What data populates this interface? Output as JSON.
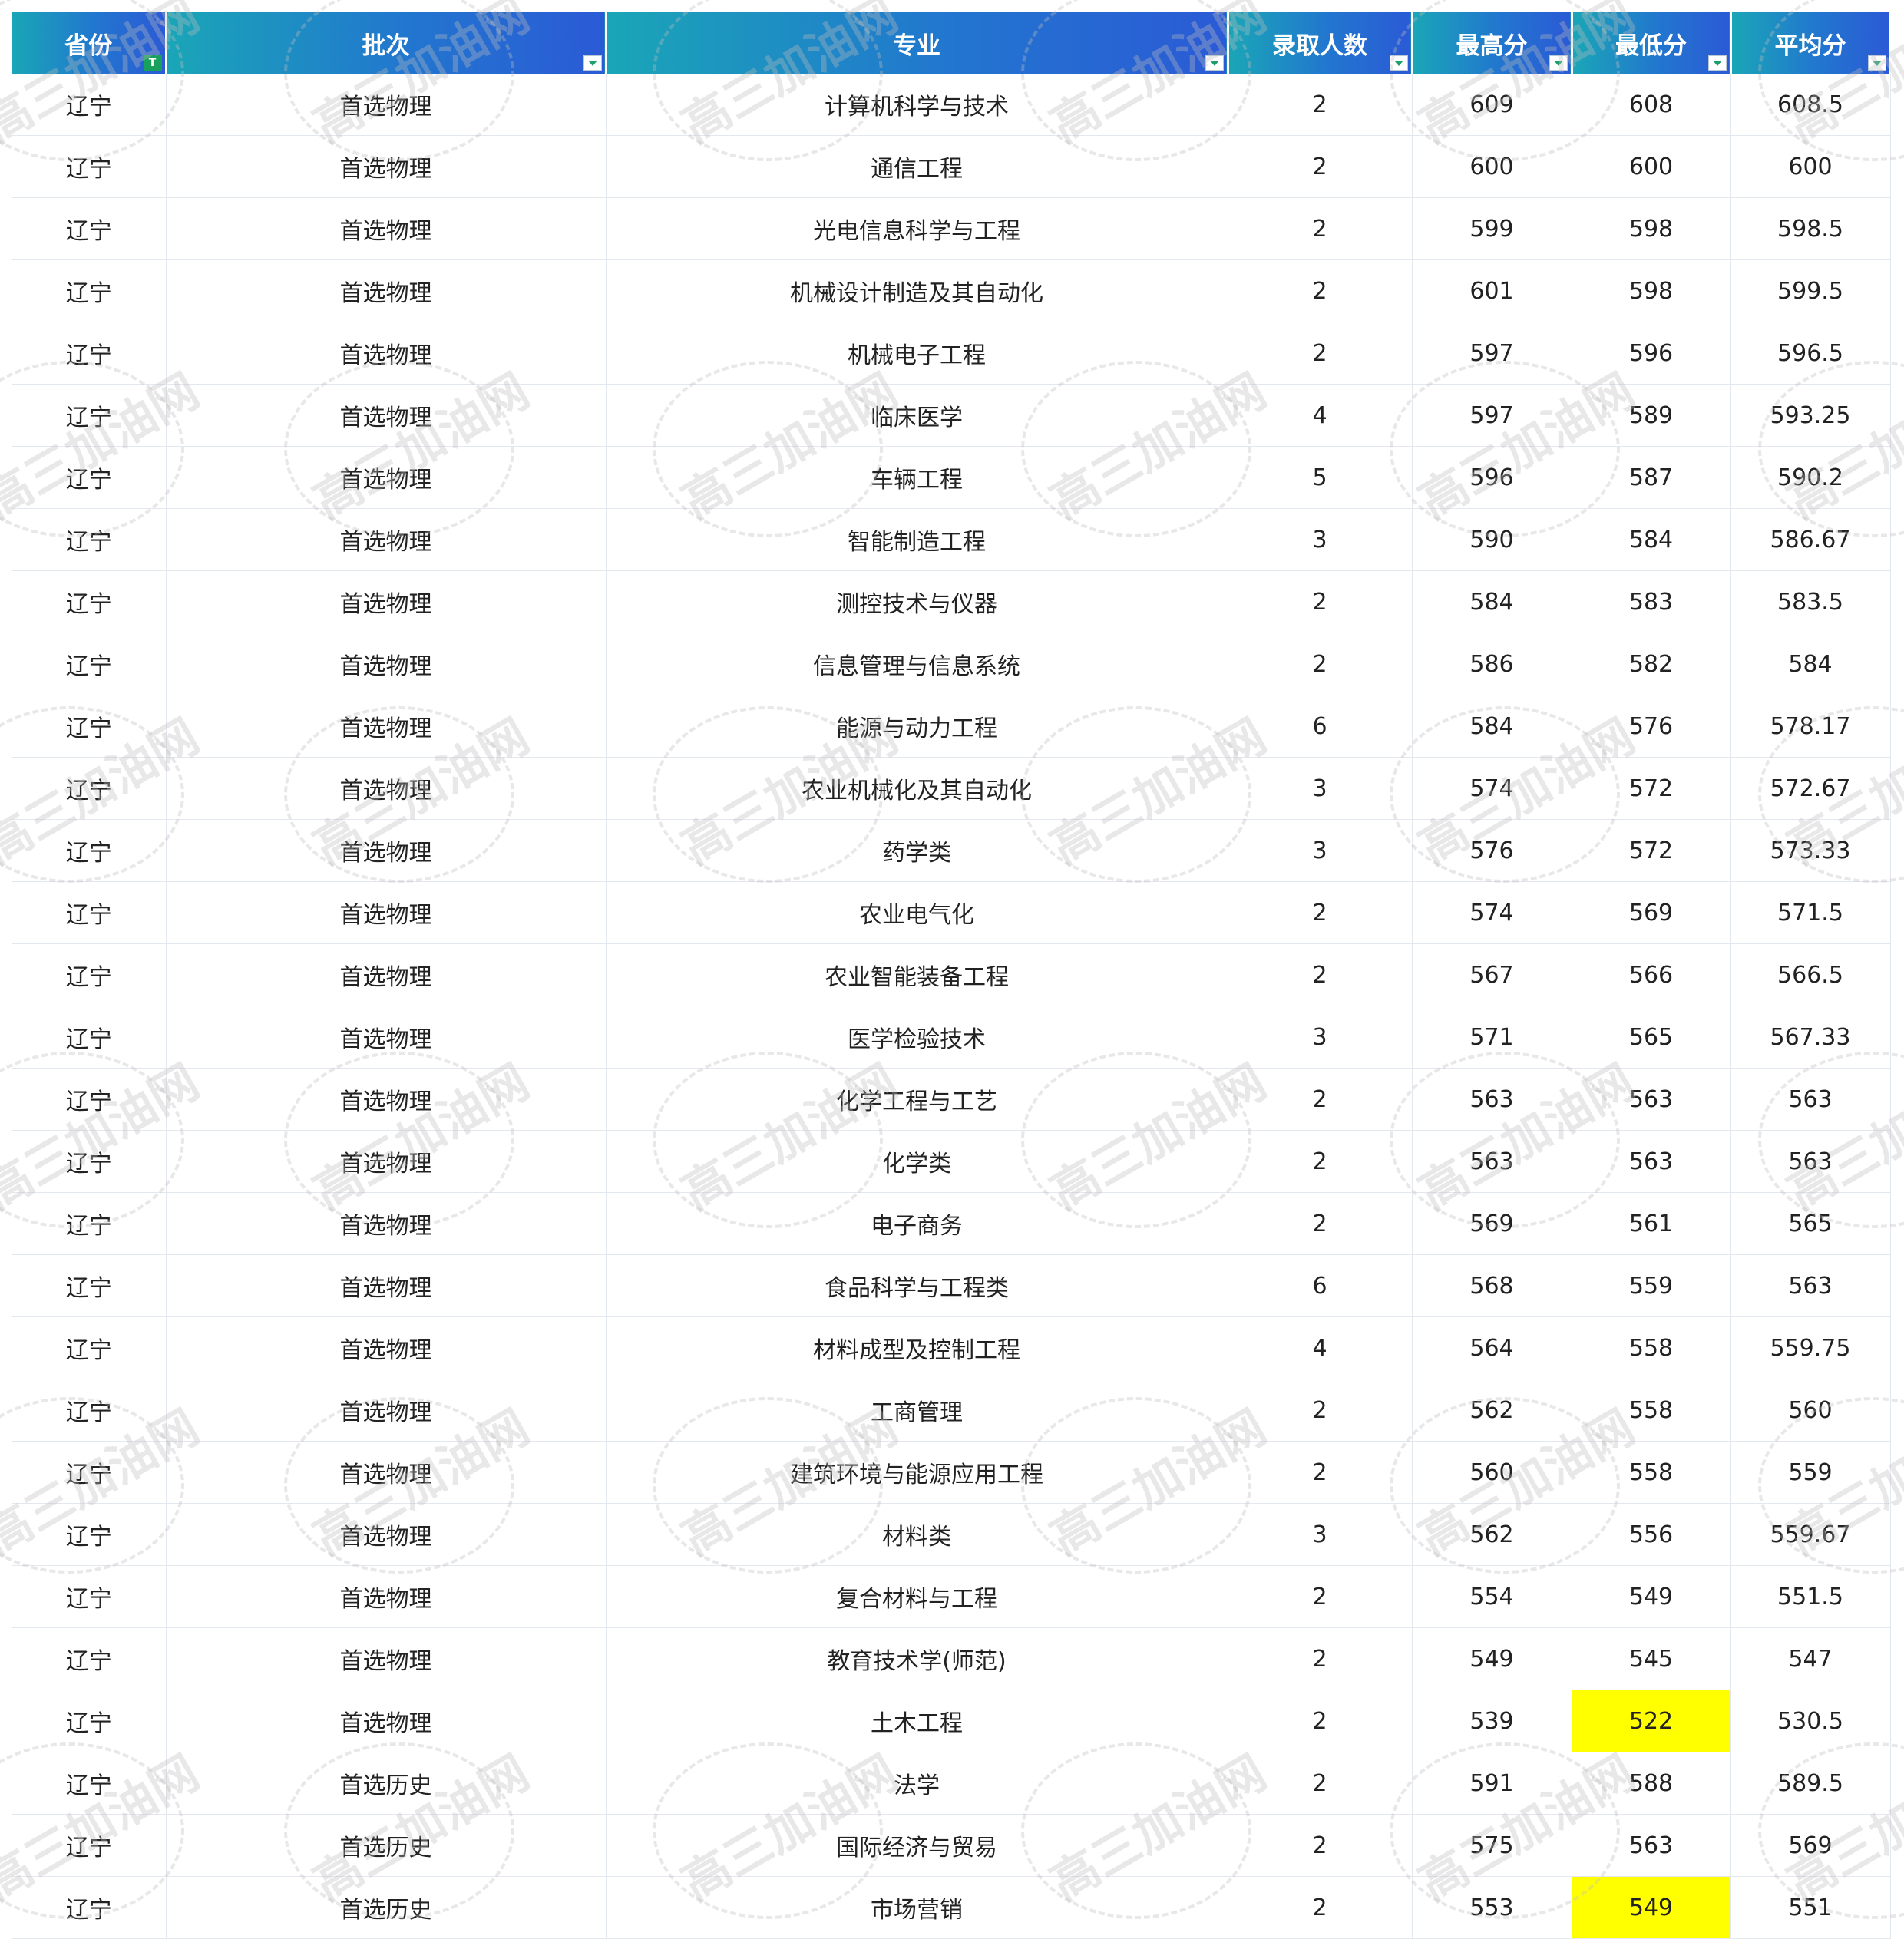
{
  "headers": [
    "省份",
    "批次",
    "专业",
    "录取人数",
    "最高分",
    "最低分",
    "平均分"
  ],
  "watermark": "高三加油网",
  "highlight_color": "#ffff00",
  "header_gradient": [
    "#1aa6b7",
    "#2276cf",
    "#2b5ad6"
  ],
  "rows": [
    [
      "辽宁",
      "首选物理",
      "计算机科学与技术",
      "2",
      "609",
      "608",
      "608.5"
    ],
    [
      "辽宁",
      "首选物理",
      "通信工程",
      "2",
      "600",
      "600",
      "600"
    ],
    [
      "辽宁",
      "首选物理",
      "光电信息科学与工程",
      "2",
      "599",
      "598",
      "598.5"
    ],
    [
      "辽宁",
      "首选物理",
      "机械设计制造及其自动化",
      "2",
      "601",
      "598",
      "599.5"
    ],
    [
      "辽宁",
      "首选物理",
      "机械电子工程",
      "2",
      "597",
      "596",
      "596.5"
    ],
    [
      "辽宁",
      "首选物理",
      "临床医学",
      "4",
      "597",
      "589",
      "593.25"
    ],
    [
      "辽宁",
      "首选物理",
      "车辆工程",
      "5",
      "596",
      "587",
      "590.2"
    ],
    [
      "辽宁",
      "首选物理",
      "智能制造工程",
      "3",
      "590",
      "584",
      "586.67"
    ],
    [
      "辽宁",
      "首选物理",
      "测控技术与仪器",
      "2",
      "584",
      "583",
      "583.5"
    ],
    [
      "辽宁",
      "首选物理",
      "信息管理与信息系统",
      "2",
      "586",
      "582",
      "584"
    ],
    [
      "辽宁",
      "首选物理",
      "能源与动力工程",
      "6",
      "584",
      "576",
      "578.17"
    ],
    [
      "辽宁",
      "首选物理",
      "农业机械化及其自动化",
      "3",
      "574",
      "572",
      "572.67"
    ],
    [
      "辽宁",
      "首选物理",
      "药学类",
      "3",
      "576",
      "572",
      "573.33"
    ],
    [
      "辽宁",
      "首选物理",
      "农业电气化",
      "2",
      "574",
      "569",
      "571.5"
    ],
    [
      "辽宁",
      "首选物理",
      "农业智能装备工程",
      "2",
      "567",
      "566",
      "566.5"
    ],
    [
      "辽宁",
      "首选物理",
      "医学检验技术",
      "3",
      "571",
      "565",
      "567.33"
    ],
    [
      "辽宁",
      "首选物理",
      "化学工程与工艺",
      "2",
      "563",
      "563",
      "563"
    ],
    [
      "辽宁",
      "首选物理",
      "化学类",
      "2",
      "563",
      "563",
      "563"
    ],
    [
      "辽宁",
      "首选物理",
      "电子商务",
      "2",
      "569",
      "561",
      "565"
    ],
    [
      "辽宁",
      "首选物理",
      "食品科学与工程类",
      "6",
      "568",
      "559",
      "563"
    ],
    [
      "辽宁",
      "首选物理",
      "材料成型及控制工程",
      "4",
      "564",
      "558",
      "559.75"
    ],
    [
      "辽宁",
      "首选物理",
      "工商管理",
      "2",
      "562",
      "558",
      "560"
    ],
    [
      "辽宁",
      "首选物理",
      "建筑环境与能源应用工程",
      "2",
      "560",
      "558",
      "559"
    ],
    [
      "辽宁",
      "首选物理",
      "材料类",
      "3",
      "562",
      "556",
      "559.67"
    ],
    [
      "辽宁",
      "首选物理",
      "复合材料与工程",
      "2",
      "554",
      "549",
      "551.5"
    ],
    [
      "辽宁",
      "首选物理",
      "教育技术学(师范)",
      "2",
      "549",
      "545",
      "547"
    ],
    [
      "辽宁",
      "首选物理",
      "土木工程",
      "2",
      "539",
      "522",
      "530.5"
    ],
    [
      "辽宁",
      "首选历史",
      "法学",
      "2",
      "591",
      "588",
      "589.5"
    ],
    [
      "辽宁",
      "首选历史",
      "国际经济与贸易",
      "2",
      "575",
      "563",
      "569"
    ],
    [
      "辽宁",
      "首选历史",
      "市场营销",
      "2",
      "553",
      "549",
      "551"
    ]
  ],
  "highlighted_cells": [
    [
      26,
      5
    ],
    [
      29,
      5
    ]
  ]
}
